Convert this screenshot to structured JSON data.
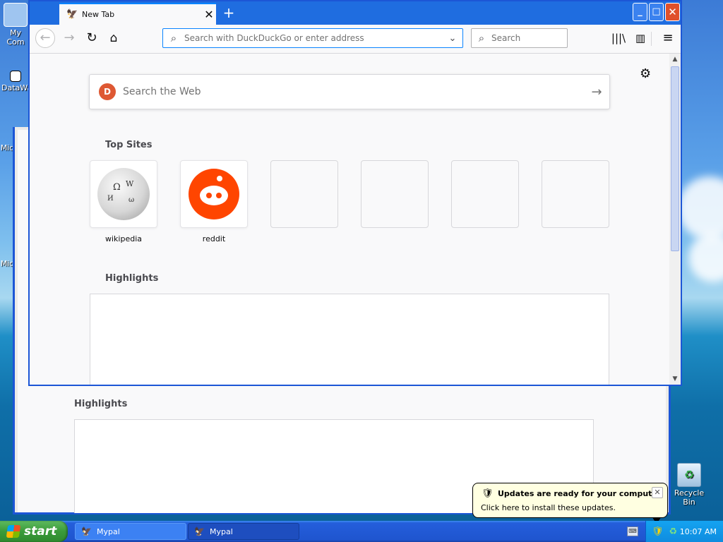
{
  "desktop": {
    "icons": [
      {
        "label": "My Com"
      },
      {
        "label": "DataWa"
      },
      {
        "label": "Mic"
      },
      {
        "label": "Mic"
      },
      {
        "label": "Recycle Bin"
      }
    ]
  },
  "background_window": {
    "highlights_title": "Highlights"
  },
  "browser": {
    "tab": {
      "title": "New Tab",
      "close": "✕"
    },
    "new_tab": "+",
    "window_buttons": {
      "minimize": "_",
      "maximize": "□",
      "close": "✕"
    },
    "urlbar": {
      "placeholder": "Search with DuckDuckGo or enter address"
    },
    "searchbar": {
      "placeholder": "Search"
    },
    "web_search": {
      "placeholder": "Search the Web"
    },
    "top_sites_title": "Top Sites",
    "top_sites": [
      {
        "label": "wikipedia"
      },
      {
        "label": "reddit"
      },
      {
        "label": ""
      },
      {
        "label": ""
      },
      {
        "label": ""
      },
      {
        "label": ""
      }
    ],
    "highlights_title": "Highlights"
  },
  "taskbar": {
    "start_label": "start",
    "buttons": [
      {
        "label": "Mypal"
      },
      {
        "label": "Mypal"
      }
    ],
    "clock": "10:07 AM"
  },
  "notification": {
    "title": "Updates are ready for your computer",
    "message": "Click here to install these updates."
  }
}
